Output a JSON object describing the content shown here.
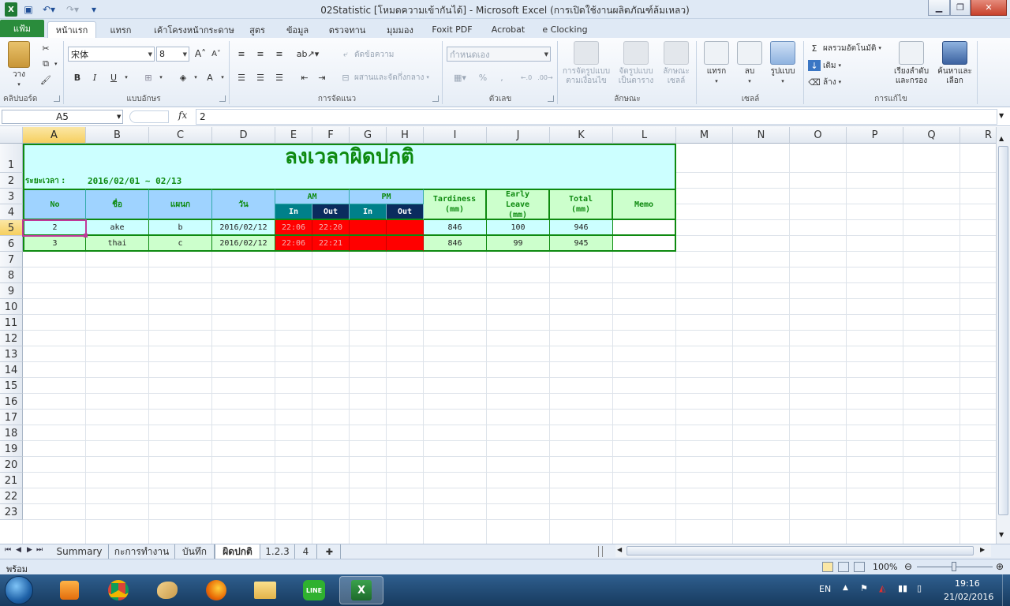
{
  "window": {
    "title": "02Statistic  [โหมดความเข้ากันได้]  -  Microsoft Excel (การเปิดใช้งานผลิตภัณฑ์ล้มเหลว)"
  },
  "ribbon": {
    "file_tab": "แฟ้ม",
    "tabs": [
      "หน้าแรก",
      "แทรก",
      "เค้าโครงหน้ากระดาษ",
      "สูตร",
      "ข้อมูล",
      "ตรวจทาน",
      "มุมมอง",
      "Foxit PDF",
      "Acrobat",
      "e Clocking"
    ],
    "clipboard": {
      "label": "คลิปบอร์ด",
      "paste": "วาง"
    },
    "font": {
      "label": "แบบอักษร",
      "name": "宋体",
      "size": "8"
    },
    "alignment": {
      "label": "การจัดแนว",
      "wrap": "ตัดข้อความ",
      "merge": "ผสานและจัดกึ่งกลาง"
    },
    "number": {
      "label": "ตัวเลข",
      "format": "กำหนดเอง"
    },
    "styles": {
      "label": "ลักษณะ",
      "cond_line1": "การจัดรูปแบบ",
      "cond_line2": "ตามเงื่อนไข",
      "table_line1": "จัดรูปแบบ",
      "table_line2": "เป็นตาราง",
      "cell_line1": "ลักษณะ",
      "cell_line2": "เซลล์"
    },
    "cells": {
      "label": "เซลล์",
      "insert": "แทรก",
      "delete": "ลบ",
      "format": "รูปแบบ"
    },
    "editing": {
      "label": "การแก้ไข",
      "autosum": "ผลรวมอัตโนมัติ",
      "fill": "เติม",
      "clear": "ล้าง",
      "sort_line1": "เรียงลำดับ",
      "sort_line2": "และกรอง",
      "find_line1": "ค้นหาและ",
      "find_line2": "เลือก"
    }
  },
  "formula_bar": {
    "name_box": "A5",
    "fx": "fx",
    "value": "2"
  },
  "columns": [
    "A",
    "B",
    "C",
    "D",
    "E",
    "F",
    "G",
    "H",
    "I",
    "J",
    "K",
    "L",
    "M",
    "N",
    "O",
    "P",
    "Q",
    "R"
  ],
  "rows": [
    "1",
    "2",
    "3",
    "4",
    "5",
    "6",
    "7",
    "8",
    "9",
    "10",
    "11",
    "12",
    "13",
    "14",
    "15",
    "16",
    "17",
    "18",
    "19",
    "20",
    "21",
    "22",
    "23"
  ],
  "sheet": {
    "title": "ลงเวลาผิดปกติ",
    "range_label": "ระยะเวลา :",
    "range_value": "2016/02/01 ~ 02/13",
    "headers": {
      "no": "No",
      "name": "ชื่อ",
      "dept": "แผนก",
      "date": "วัน",
      "am": "AM",
      "pm": "PM",
      "in": "In",
      "out": "Out",
      "tardiness_1": "Tardiness",
      "tardiness_2": "(mm)",
      "early_1": "Early",
      "early_2": "Leave",
      "early_3": "(mm)",
      "total_1": "Total",
      "total_2": "(mm)",
      "memo": "Memo"
    },
    "records": [
      {
        "no": "2",
        "name": "ake",
        "dept": "b",
        "date": "2016/02/12",
        "am_in": "22:06",
        "am_out": "22:20",
        "pm_in": "",
        "pm_out": "",
        "tardiness": "846",
        "early": "100",
        "total": "946",
        "memo": ""
      },
      {
        "no": "3",
        "name": "thai",
        "dept": "c",
        "date": "2016/02/12",
        "am_in": "22:06",
        "am_out": "22:21",
        "pm_in": "",
        "pm_out": "",
        "tardiness": "846",
        "early": "99",
        "total": "945",
        "memo": ""
      }
    ]
  },
  "sheet_tabs": [
    "Summary",
    "กะการทำงาน",
    "บันทึก",
    "ผิดปกติ",
    "1.2.3",
    "4"
  ],
  "active_sheet": "ผิดปกติ",
  "status": {
    "ready": "พร้อม",
    "zoom": "100%"
  },
  "taskbar": {
    "lang": "EN",
    "time": "19:16",
    "date": "21/02/2016"
  },
  "colors": {
    "accent_green": "#0e8a10",
    "cyan_fill": "#ccffff",
    "light_green": "#ccffcc",
    "red_fill": "#ff0000",
    "teal": "#00808a",
    "navy": "#0a2c5e"
  }
}
